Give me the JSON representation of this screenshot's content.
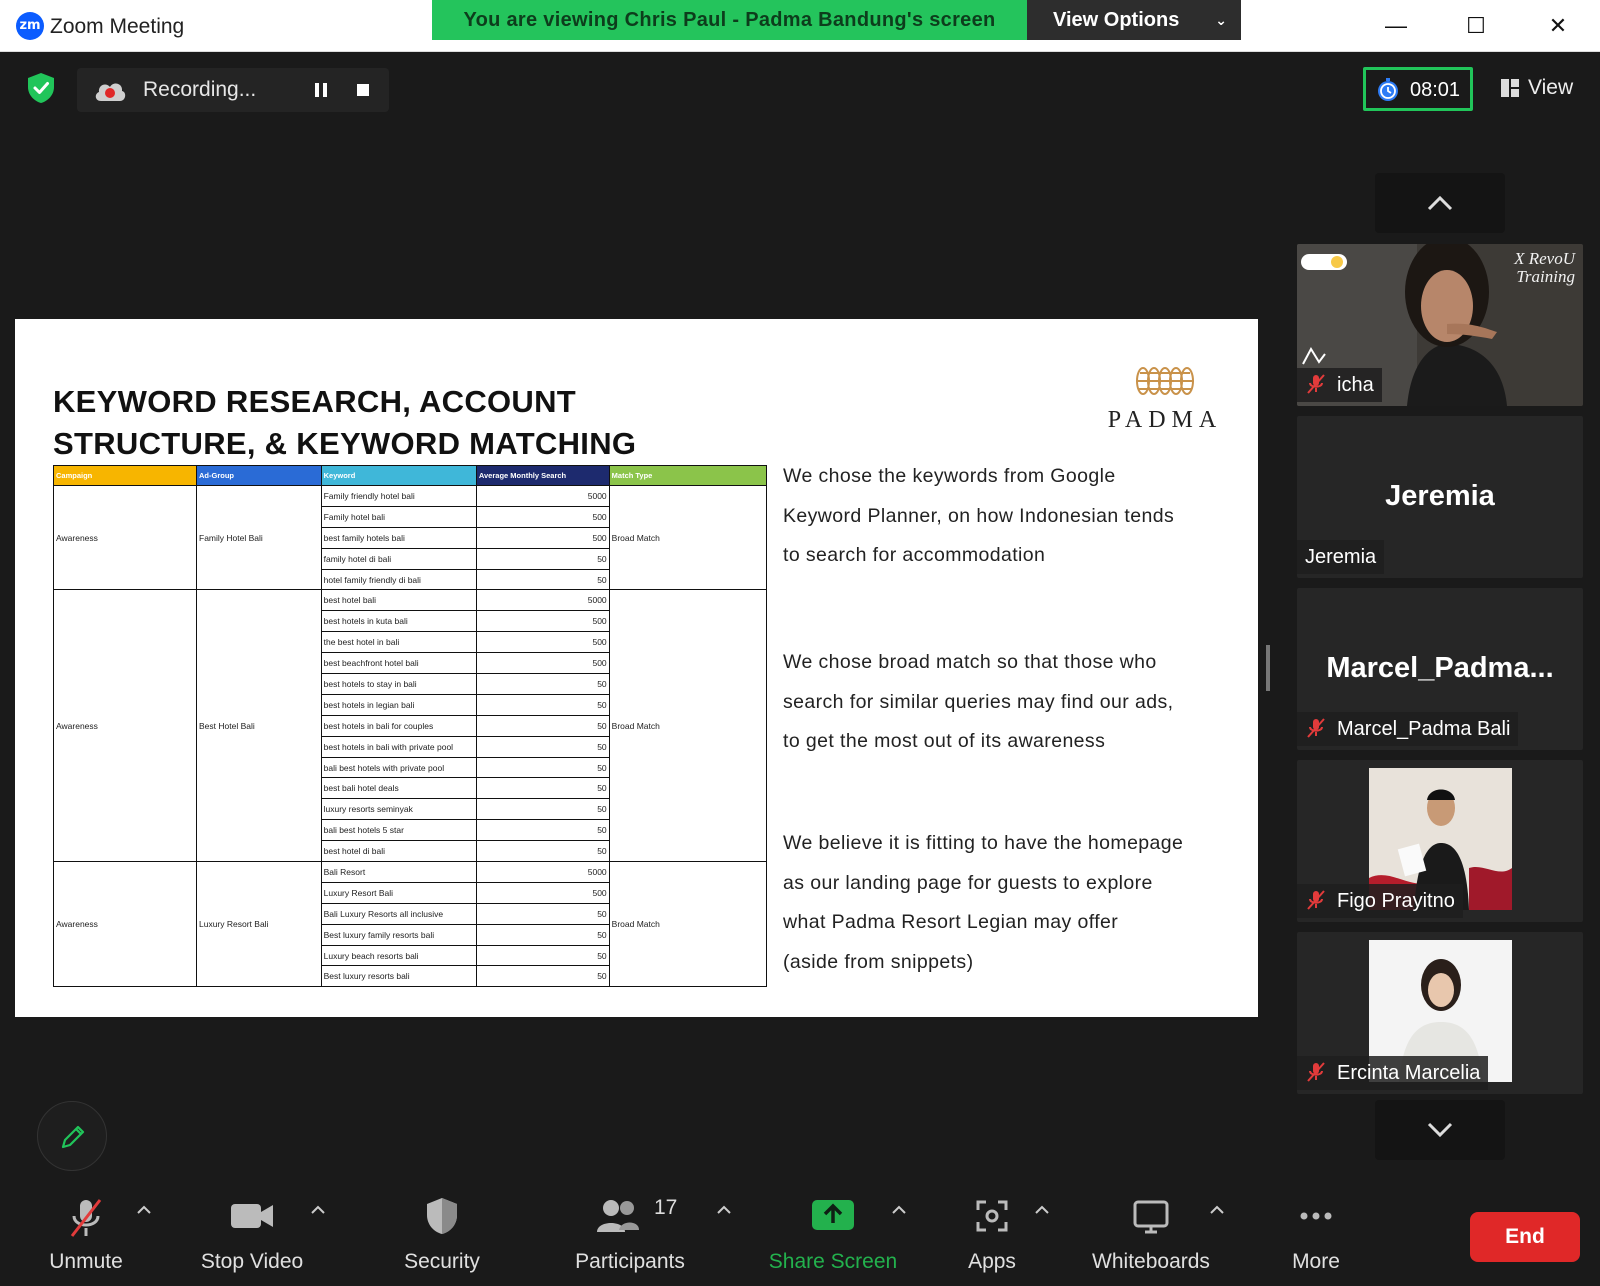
{
  "window": {
    "logo_text": "zm",
    "title": "Zoom Meeting",
    "minimize": "—",
    "maximize": "☐",
    "close": "✕"
  },
  "banner": {
    "viewing_text": "You are viewing Chris Paul - Padma Bandung's screen",
    "view_options_label": "View Options"
  },
  "recording": {
    "label": "Recording..."
  },
  "timer": {
    "value": "08:01"
  },
  "view_button": {
    "label": "View"
  },
  "slide": {
    "title_line1": "KEYWORD RESEARCH, ACCOUNT",
    "title_line2": "STRUCTURE, & KEYWORD MATCHING",
    "logo_word": "PADMA",
    "table": {
      "headers": [
        "Campaign",
        "Ad-Group",
        "Keyword",
        "Average Monthly Search",
        "Match Type"
      ],
      "header_colors": [
        "#f7b500",
        "#2a6bd6",
        "#3fb7d9",
        "#1d2a6e",
        "#8bc44a"
      ],
      "groups": [
        {
          "campaign": "Awareness",
          "ad_group": "Family Hotel Bali",
          "match_type": "Broad Match",
          "rows": [
            {
              "keyword": "Family friendly hotel bali",
              "searches": "5000"
            },
            {
              "keyword": "Family hotel bali",
              "searches": "500"
            },
            {
              "keyword": "best family hotels bali",
              "searches": "500"
            },
            {
              "keyword": "family hotel di bali",
              "searches": "50"
            },
            {
              "keyword": "hotel family friendly di bali",
              "searches": "50"
            }
          ]
        },
        {
          "campaign": "Awareness",
          "ad_group": "Best Hotel Bali",
          "match_type": "Broad Match",
          "rows": [
            {
              "keyword": "best hotel bali",
              "searches": "5000"
            },
            {
              "keyword": "best hotels in kuta bali",
              "searches": "500"
            },
            {
              "keyword": "the best hotel in bali",
              "searches": "500"
            },
            {
              "keyword": "best beachfront hotel bali",
              "searches": "500"
            },
            {
              "keyword": "best hotels to stay in bali",
              "searches": "50"
            },
            {
              "keyword": "best hotels in legian bali",
              "searches": "50"
            },
            {
              "keyword": "best hotels in bali for couples",
              "searches": "50"
            },
            {
              "keyword": "best hotels in bali with private pool",
              "searches": "50"
            },
            {
              "keyword": "bali best hotels with private pool",
              "searches": "50"
            },
            {
              "keyword": "best bali hotel deals",
              "searches": "50"
            },
            {
              "keyword": "luxury resorts seminyak",
              "searches": "50"
            },
            {
              "keyword": "bali best hotels 5 star",
              "searches": "50"
            },
            {
              "keyword": "best hotel di bali",
              "searches": "50"
            }
          ]
        },
        {
          "campaign": "Awareness",
          "ad_group": "Luxury Resort Bali",
          "match_type": "Broad Match",
          "rows": [
            {
              "keyword": "Bali Resort",
              "searches": "5000"
            },
            {
              "keyword": "Luxury Resort Bali",
              "searches": "500"
            },
            {
              "keyword": "Bali Luxury Resorts all inclusive",
              "searches": "50"
            },
            {
              "keyword": "Best luxury family resorts bali",
              "searches": "50"
            },
            {
              "keyword": "Luxury beach resorts bali",
              "searches": "50"
            },
            {
              "keyword": "Best luxury resorts bali",
              "searches": "50"
            }
          ]
        }
      ]
    },
    "paragraph1": [
      "We chose the keywords from Google",
      "Keyword Planner, on how Indonesian tends",
      "to search for accommodation"
    ],
    "paragraph2": [
      "We chose broad match so that those who",
      "search for similar queries may find our ads,",
      "to get the most out of its awareness"
    ],
    "paragraph3": [
      "We believe it is fitting to have the homepage",
      "as our landing page for guests to explore",
      "what Padma Resort Legian may offer",
      "(aside from snippets)"
    ]
  },
  "gallery": {
    "tiles": [
      {
        "name": "icha",
        "overlay_line1": "X RevoU",
        "overlay_line2": "Training"
      },
      {
        "big_name": "Jeremia",
        "name": "Jeremia"
      },
      {
        "big_name": "Marcel_Padma...",
        "name": "Marcel_Padma Bali"
      },
      {
        "name": "Figo Prayitno"
      },
      {
        "name": "Ercinta Marcelia"
      }
    ]
  },
  "toolbar": {
    "unmute": "Unmute",
    "stop_video": "Stop Video",
    "security": "Security",
    "participants": "Participants",
    "participants_count": "17",
    "share_screen": "Share Screen",
    "apps": "Apps",
    "whiteboards": "Whiteboards",
    "more": "More",
    "end": "End"
  },
  "colors": {
    "banner_green": "#24c45c",
    "share_green": "#23b14d",
    "end_red": "#e02828",
    "timer_border": "#21c55a"
  }
}
